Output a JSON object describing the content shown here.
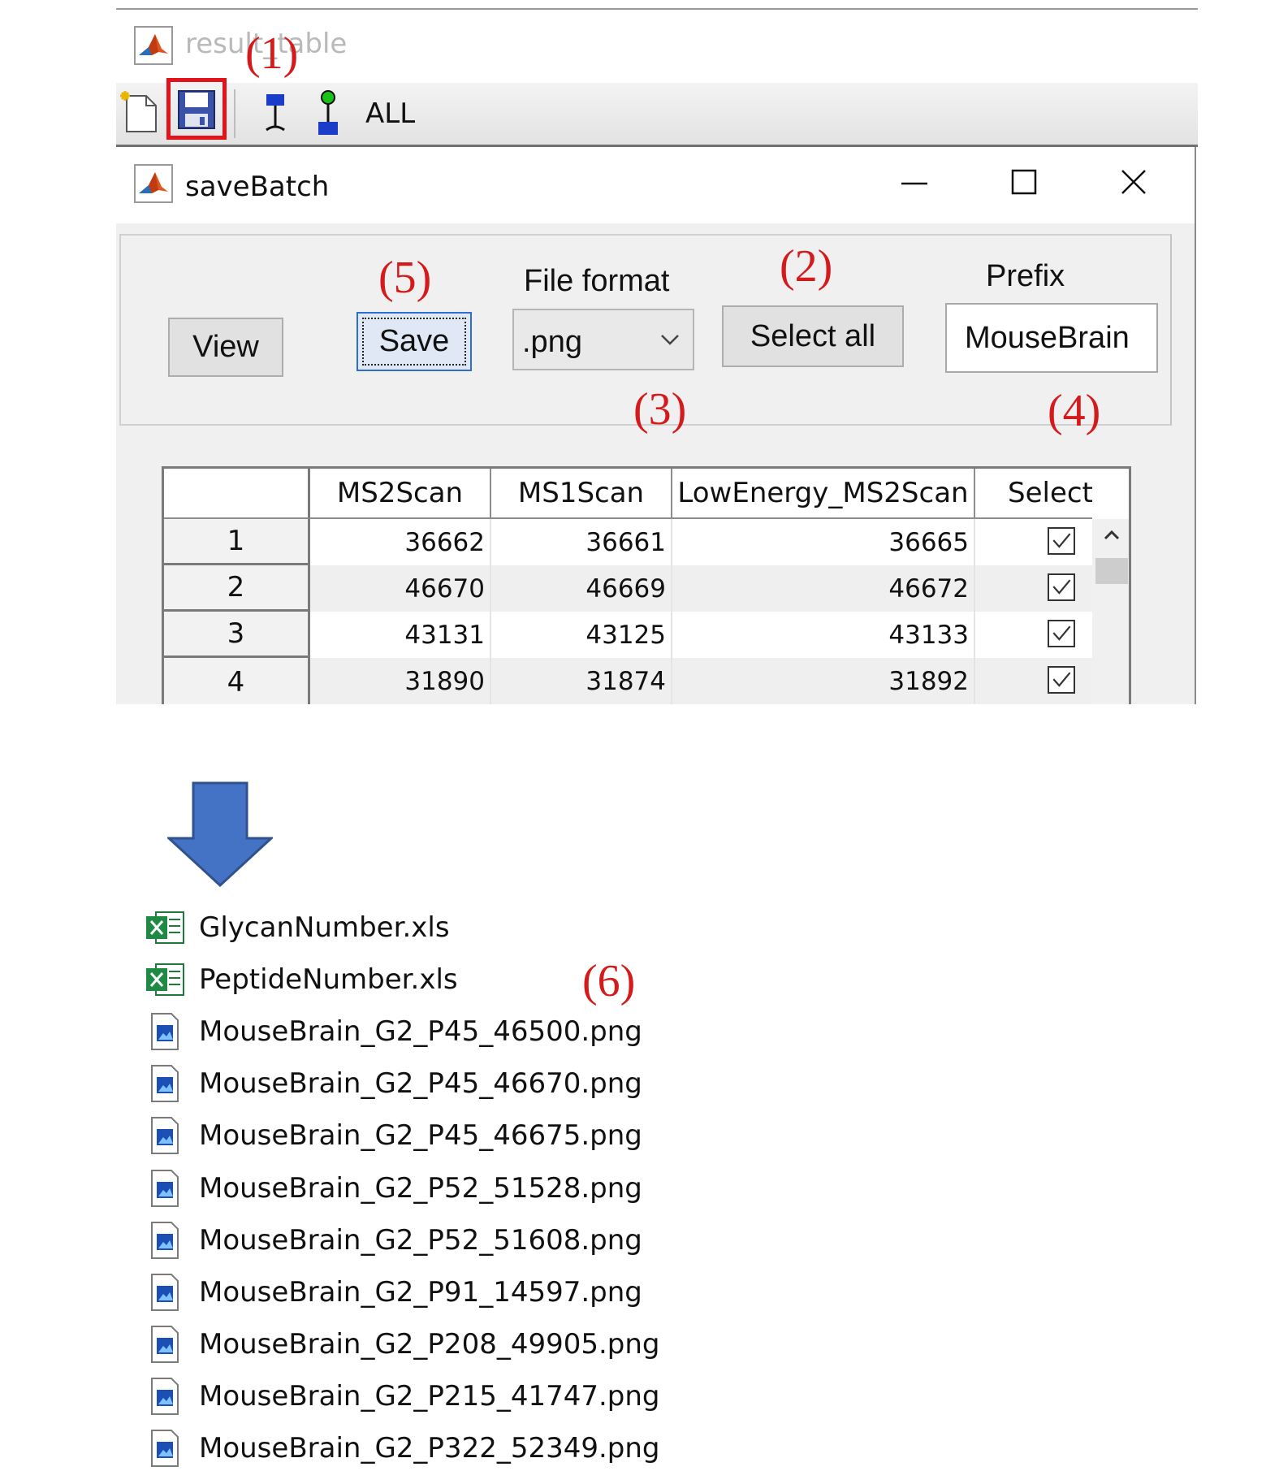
{
  "result_window": {
    "title": "result_table",
    "toolbar": {
      "all_label": "ALL"
    }
  },
  "savebatch_window": {
    "title": "saveBatch",
    "view_button": "View",
    "save_button": "Save",
    "file_format_label": "File format",
    "file_format_value": ".png",
    "select_all_button": "Select all",
    "prefix_label": "Prefix",
    "prefix_value": "MouseBrain"
  },
  "table": {
    "columns": [
      "MS2Scan",
      "MS1Scan",
      "LowEnergy_MS2Scan",
      "Select"
    ],
    "rows": [
      {
        "index": "1",
        "ms2": "36662",
        "ms1": "36661",
        "low": "36665",
        "selected": true
      },
      {
        "index": "2",
        "ms2": "46670",
        "ms1": "46669",
        "low": "46672",
        "selected": true
      },
      {
        "index": "3",
        "ms2": "43131",
        "ms1": "43125",
        "low": "43133",
        "selected": true
      },
      {
        "index": "4",
        "ms2": "31890",
        "ms1": "31874",
        "low": "31892",
        "selected": true
      }
    ]
  },
  "annotations": {
    "a1": "(1)",
    "a2": "(2)",
    "a3": "(3)",
    "a4": "(4)",
    "a5": "(5)",
    "a6": "(6)"
  },
  "files": [
    {
      "name": "GlycanNumber.xls",
      "icon": "excel-icon"
    },
    {
      "name": "PeptideNumber.xls",
      "icon": "excel-icon"
    },
    {
      "name": "MouseBrain_G2_P45_46500.png",
      "icon": "image-file-icon"
    },
    {
      "name": "MouseBrain_G2_P45_46670.png",
      "icon": "image-file-icon"
    },
    {
      "name": "MouseBrain_G2_P45_46675.png",
      "icon": "image-file-icon"
    },
    {
      "name": "MouseBrain_G2_P52_51528.png",
      "icon": "image-file-icon"
    },
    {
      "name": "MouseBrain_G2_P52_51608.png",
      "icon": "image-file-icon"
    },
    {
      "name": "MouseBrain_G2_P91_14597.png",
      "icon": "image-file-icon"
    },
    {
      "name": "MouseBrain_G2_P208_49905.png",
      "icon": "image-file-icon"
    },
    {
      "name": "MouseBrain_G2_P215_41747.png",
      "icon": "image-file-icon"
    },
    {
      "name": "MouseBrain_G2_P322_52349.png",
      "icon": "image-file-icon"
    }
  ],
  "colors": {
    "annotation_red": "#d41a1a",
    "highlight_red": "#e3131b",
    "arrow_blue": "#4472c4"
  }
}
